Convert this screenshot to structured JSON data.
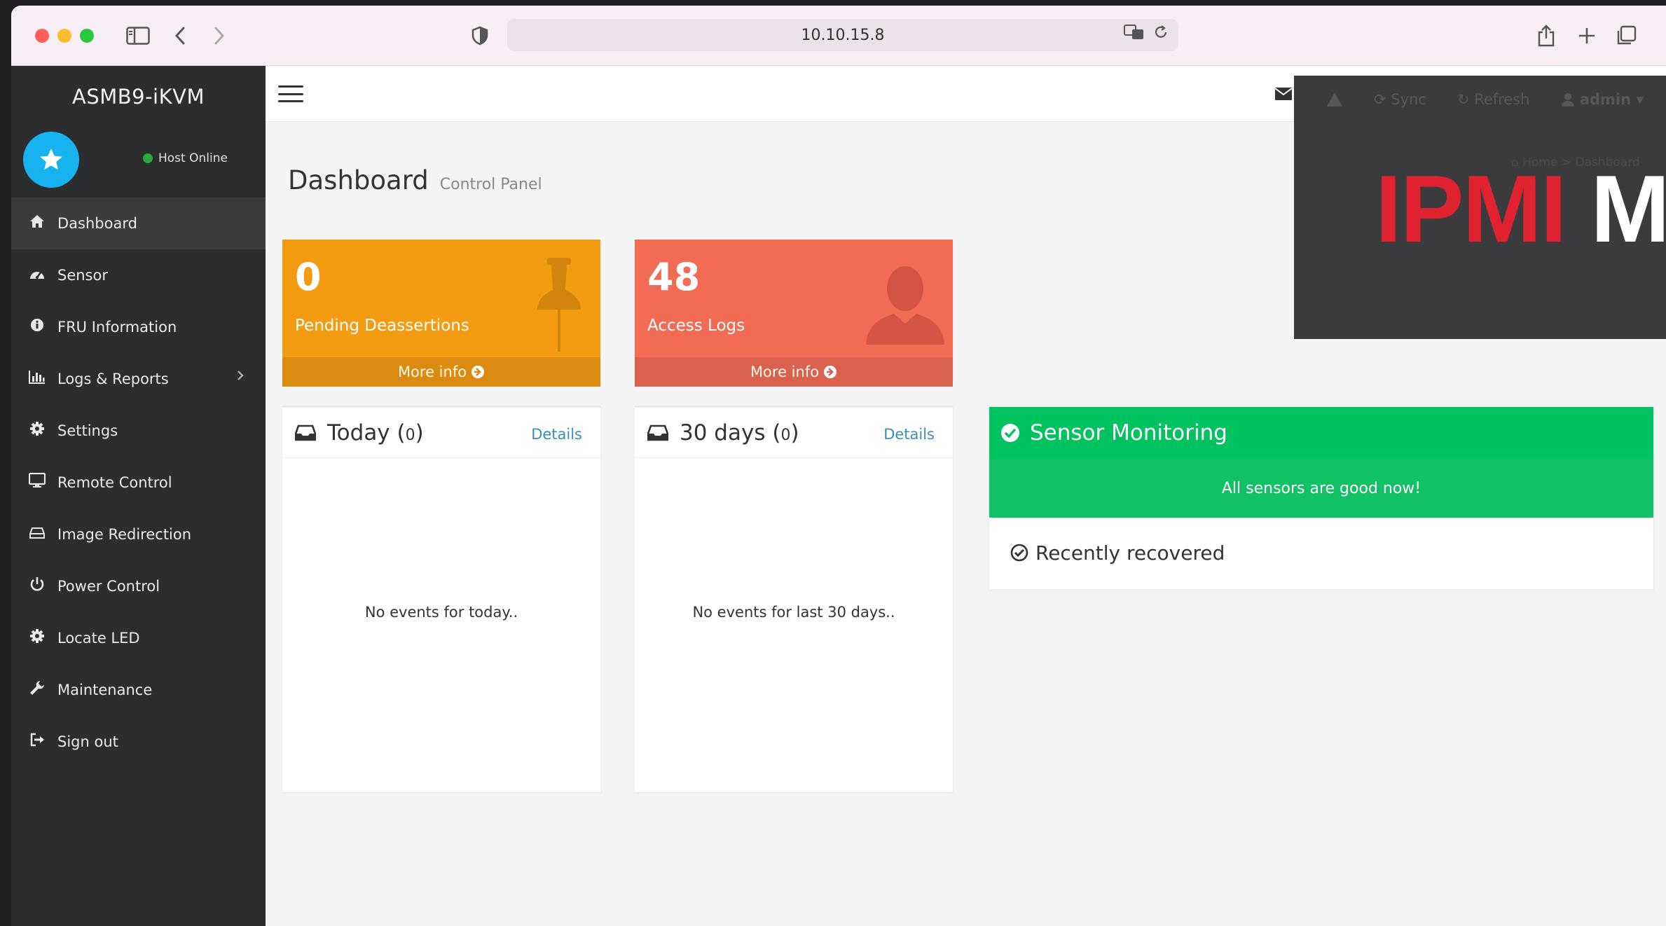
{
  "browser": {
    "url": "10.10.15.8"
  },
  "sidebar": {
    "brand": "ASMB9-iKVM",
    "status": "Host Online",
    "items": [
      {
        "label": "Dashboard",
        "icon": "home-icon"
      },
      {
        "label": "Sensor",
        "icon": "dashboard-gauge-icon"
      },
      {
        "label": "FRU Information",
        "icon": "info-circle-icon"
      },
      {
        "label": "Logs & Reports",
        "icon": "bar-chart-icon"
      },
      {
        "label": "Settings",
        "icon": "gear-icon"
      },
      {
        "label": "Remote Control",
        "icon": "desktop-icon"
      },
      {
        "label": "Image Redirection",
        "icon": "hdd-icon"
      },
      {
        "label": "Power Control",
        "icon": "power-icon"
      },
      {
        "label": "Locate LED",
        "icon": "gear-icon"
      },
      {
        "label": "Maintenance",
        "icon": "wrench-icon"
      },
      {
        "label": "Sign out",
        "icon": "sign-out-icon"
      }
    ]
  },
  "header": {
    "title": "Dashboard",
    "subtitle": "Control Panel"
  },
  "info_boxes": [
    {
      "value": "0",
      "label": "Pending Deassertions",
      "more": "More info",
      "color": "#f39c12"
    },
    {
      "value": "48",
      "label": "Access Logs",
      "more": "More info",
      "color": "#f26c55"
    }
  ],
  "panels": {
    "today": {
      "title": "Today",
      "count": "0",
      "link": "Details",
      "empty": "No events for today.."
    },
    "days30": {
      "title": "30 days",
      "count": "0",
      "link": "Details",
      "empty": "No events for last 30 days.."
    }
  },
  "sensor": {
    "title": "Sensor Monitoring",
    "status": "All sensors are good now!",
    "recovered": "Recently recovered",
    "color": "#00c261"
  },
  "overlay": {
    "nav": [
      "Sync",
      "Refresh",
      "admin"
    ],
    "crumb_home": "Home",
    "crumb_current": "Dashboard",
    "banner_red": "IPMI",
    "banner_white": "M"
  }
}
